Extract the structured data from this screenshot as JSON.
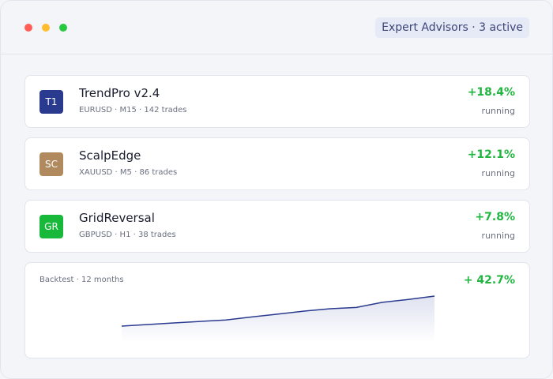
{
  "window": {
    "controls": [
      {
        "name": "close",
        "color": "#ff5f57"
      },
      {
        "name": "minimize",
        "color": "#febc2e"
      },
      {
        "name": "zoom",
        "color": "#28c840"
      }
    ],
    "badge": {
      "label": "Expert Advisors · 3 active",
      "bg": "#e6e9f6",
      "color": "#3d4778"
    }
  },
  "experts": [
    {
      "initials": "T1",
      "avatar_color": "#2a3a8f",
      "name": "TrendPro v2.4",
      "meta": "EURUSD · M15 · 142 trades",
      "return": "+18.4%",
      "status": "running"
    },
    {
      "initials": "SC",
      "avatar_color": "#b08a5e",
      "name": "ScalpEdge",
      "meta": "XAUUSD · M5 · 86 trades",
      "return": "+12.1%",
      "status": "running"
    },
    {
      "initials": "GR",
      "avatar_color": "#18b83a",
      "name": "GridReversal",
      "meta": "GBPUSD · H1 · 38 trades",
      "return": "+7.8%",
      "status": "running"
    }
  ],
  "backtest": {
    "label": "Backtest · 12 months",
    "value": "+ 42.7%"
  },
  "colors": {
    "positive": "#1fb53f",
    "line": "#2a3a8f",
    "fill": "#dfe2f0"
  },
  "chart_data": {
    "type": "area",
    "x": [
      0,
      1,
      2,
      3,
      4,
      5,
      6,
      7,
      8,
      9,
      10,
      11,
      12
    ],
    "values": [
      0,
      2.3,
      4.5,
      6.6,
      8.8,
      13.0,
      17.2,
      21.3,
      24.7,
      26.5,
      33.8,
      38.0,
      42.7
    ],
    "title": "Backtest · 12 months",
    "xlabel": "",
    "ylabel": "",
    "ylim": [
      0,
      42.7
    ],
    "grid": false,
    "legend": "none"
  }
}
